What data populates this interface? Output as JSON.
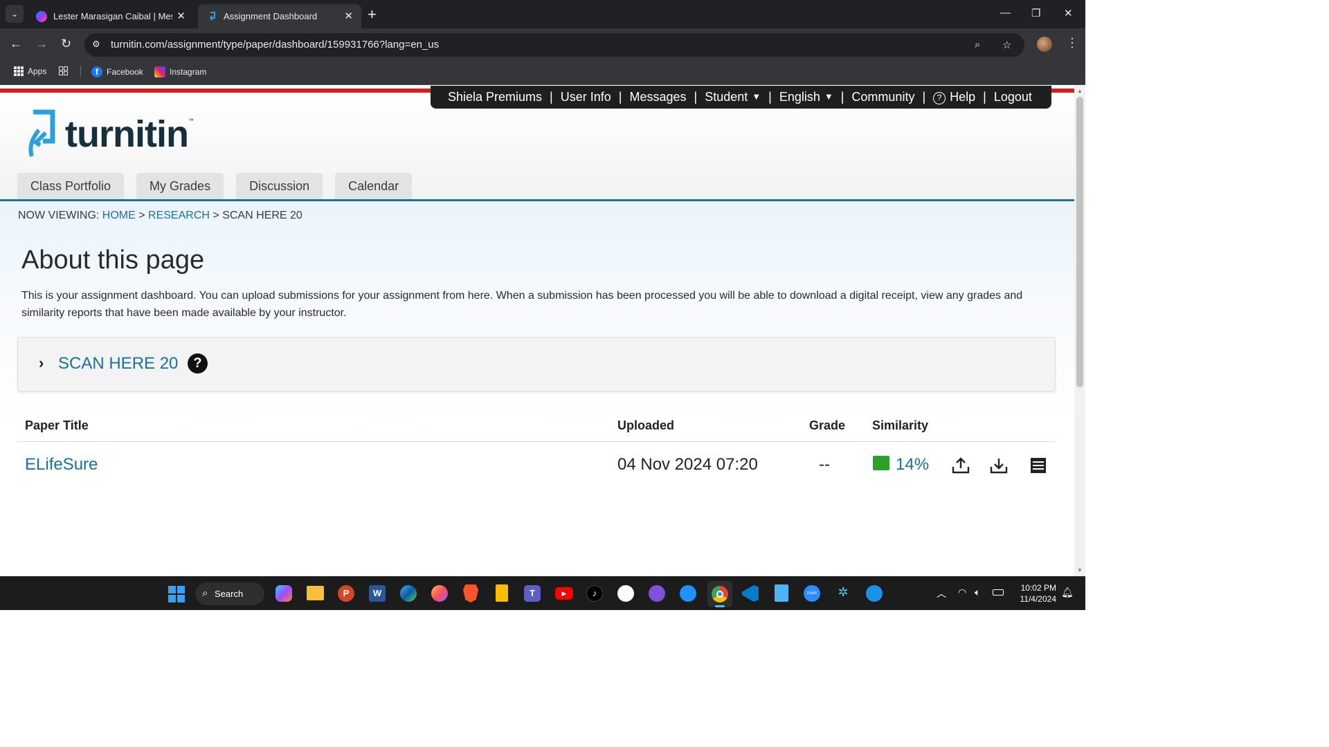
{
  "browser": {
    "tabs": [
      {
        "title": "Lester Marasigan Caibal | Messenger",
        "active": false,
        "icon": "messenger-icon"
      },
      {
        "title": "Assignment Dashboard",
        "active": true,
        "icon": "turnitin-icon"
      }
    ],
    "url": "turnitin.com/assignment/type/paper/dashboard/159931766?lang=en_us",
    "bookmarks": [
      {
        "label": "Apps",
        "icon": "apps-grid-icon"
      },
      {
        "label": "Facebook",
        "icon": "facebook-icon"
      },
      {
        "label": "Instagram",
        "icon": "instagram-icon"
      }
    ]
  },
  "header": {
    "topnav": {
      "user": "Shiela Premiums",
      "user_info": "User Info",
      "messages": "Messages",
      "role": "Student",
      "language": "English",
      "community": "Community",
      "help": "Help",
      "logout": "Logout"
    },
    "logo_text": "turnitin",
    "logo_tm": "™",
    "tabs": [
      "Class Portfolio",
      "My Grades",
      "Discussion",
      "Calendar"
    ]
  },
  "breadcrumb": {
    "prefix": "NOW VIEWING:",
    "home": "HOME",
    "research": "RESEARCH",
    "current": "SCAN HERE 20",
    "sep": ">"
  },
  "about": {
    "title": "About this page",
    "description": "This is your assignment dashboard. You can upload submissions for your assignment from here. When a submission has been processed you will be able to download a digital receipt, view any grades and similarity reports that have been made available by your instructor."
  },
  "assignment": {
    "title": "SCAN HERE 20",
    "help_symbol": "?"
  },
  "table": {
    "headers": {
      "paper_title": "Paper Title",
      "uploaded": "Uploaded",
      "grade": "Grade",
      "similarity": "Similarity"
    },
    "rows": [
      {
        "paper_title": "ELifeSure",
        "uploaded": "04 Nov 2024 07:20",
        "grade": "--",
        "similarity": "14%",
        "similarity_color": "#2ca02c"
      }
    ]
  },
  "taskbar": {
    "search_label": "Search",
    "time": "10:02 PM",
    "date": "11/4/2024"
  }
}
